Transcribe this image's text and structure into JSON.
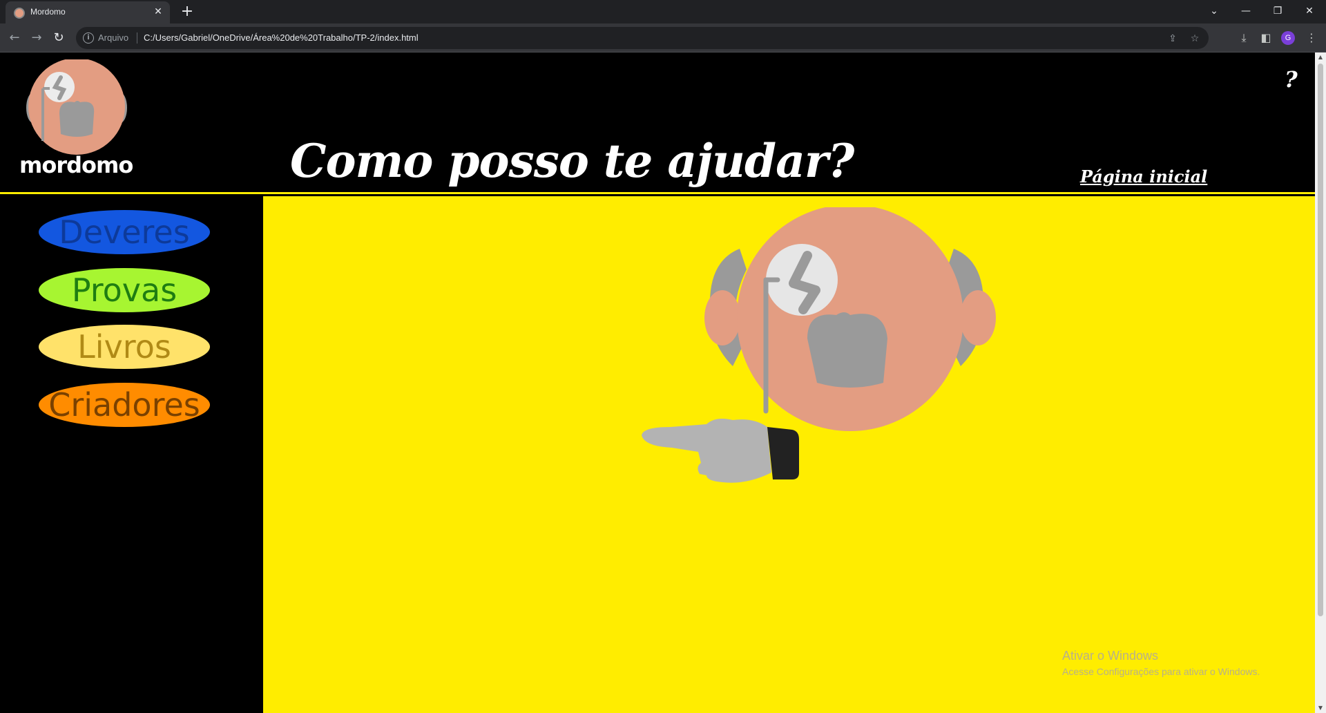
{
  "browser": {
    "tab_title": "Mordomo",
    "address_label": "Arquivo",
    "url": "C:/Users/Gabriel/OneDrive/Área%20de%20Trabalho/TP-2/index.html",
    "profile_initial": "G"
  },
  "header": {
    "brand": "mordomo",
    "headline": "Como posso te ajudar?",
    "home_link": "Página inicial",
    "help_label": "?"
  },
  "sidebar": {
    "items": [
      {
        "label": "Deveres",
        "color": "#1357e0"
      },
      {
        "label": "Provas",
        "color": "#a7f531"
      },
      {
        "label": "Livros",
        "color": "#ffe26a"
      },
      {
        "label": "Criadores",
        "color": "#ff8c00"
      }
    ]
  },
  "main": {
    "background": "#ffed00",
    "watermark_title": "Ativar o Windows",
    "watermark_subtitle": "Acesse Configurações para ativar o Windows."
  }
}
